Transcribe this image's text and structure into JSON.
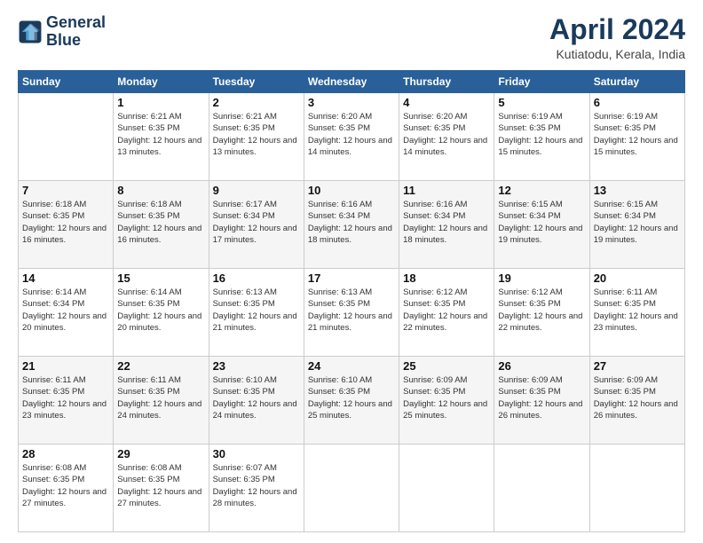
{
  "logo": {
    "line1": "General",
    "line2": "Blue"
  },
  "title": "April 2024",
  "subtitle": "Kutiatodu, Kerala, India",
  "days_of_week": [
    "Sunday",
    "Monday",
    "Tuesday",
    "Wednesday",
    "Thursday",
    "Friday",
    "Saturday"
  ],
  "weeks": [
    [
      {
        "day": "",
        "sunrise": "",
        "sunset": "",
        "daylight": ""
      },
      {
        "day": "1",
        "sunrise": "Sunrise: 6:21 AM",
        "sunset": "Sunset: 6:35 PM",
        "daylight": "Daylight: 12 hours and 13 minutes."
      },
      {
        "day": "2",
        "sunrise": "Sunrise: 6:21 AM",
        "sunset": "Sunset: 6:35 PM",
        "daylight": "Daylight: 12 hours and 13 minutes."
      },
      {
        "day": "3",
        "sunrise": "Sunrise: 6:20 AM",
        "sunset": "Sunset: 6:35 PM",
        "daylight": "Daylight: 12 hours and 14 minutes."
      },
      {
        "day": "4",
        "sunrise": "Sunrise: 6:20 AM",
        "sunset": "Sunset: 6:35 PM",
        "daylight": "Daylight: 12 hours and 14 minutes."
      },
      {
        "day": "5",
        "sunrise": "Sunrise: 6:19 AM",
        "sunset": "Sunset: 6:35 PM",
        "daylight": "Daylight: 12 hours and 15 minutes."
      },
      {
        "day": "6",
        "sunrise": "Sunrise: 6:19 AM",
        "sunset": "Sunset: 6:35 PM",
        "daylight": "Daylight: 12 hours and 15 minutes."
      }
    ],
    [
      {
        "day": "7",
        "sunrise": "Sunrise: 6:18 AM",
        "sunset": "Sunset: 6:35 PM",
        "daylight": "Daylight: 12 hours and 16 minutes."
      },
      {
        "day": "8",
        "sunrise": "Sunrise: 6:18 AM",
        "sunset": "Sunset: 6:35 PM",
        "daylight": "Daylight: 12 hours and 16 minutes."
      },
      {
        "day": "9",
        "sunrise": "Sunrise: 6:17 AM",
        "sunset": "Sunset: 6:34 PM",
        "daylight": "Daylight: 12 hours and 17 minutes."
      },
      {
        "day": "10",
        "sunrise": "Sunrise: 6:16 AM",
        "sunset": "Sunset: 6:34 PM",
        "daylight": "Daylight: 12 hours and 18 minutes."
      },
      {
        "day": "11",
        "sunrise": "Sunrise: 6:16 AM",
        "sunset": "Sunset: 6:34 PM",
        "daylight": "Daylight: 12 hours and 18 minutes."
      },
      {
        "day": "12",
        "sunrise": "Sunrise: 6:15 AM",
        "sunset": "Sunset: 6:34 PM",
        "daylight": "Daylight: 12 hours and 19 minutes."
      },
      {
        "day": "13",
        "sunrise": "Sunrise: 6:15 AM",
        "sunset": "Sunset: 6:34 PM",
        "daylight": "Daylight: 12 hours and 19 minutes."
      }
    ],
    [
      {
        "day": "14",
        "sunrise": "Sunrise: 6:14 AM",
        "sunset": "Sunset: 6:34 PM",
        "daylight": "Daylight: 12 hours and 20 minutes."
      },
      {
        "day": "15",
        "sunrise": "Sunrise: 6:14 AM",
        "sunset": "Sunset: 6:35 PM",
        "daylight": "Daylight: 12 hours and 20 minutes."
      },
      {
        "day": "16",
        "sunrise": "Sunrise: 6:13 AM",
        "sunset": "Sunset: 6:35 PM",
        "daylight": "Daylight: 12 hours and 21 minutes."
      },
      {
        "day": "17",
        "sunrise": "Sunrise: 6:13 AM",
        "sunset": "Sunset: 6:35 PM",
        "daylight": "Daylight: 12 hours and 21 minutes."
      },
      {
        "day": "18",
        "sunrise": "Sunrise: 6:12 AM",
        "sunset": "Sunset: 6:35 PM",
        "daylight": "Daylight: 12 hours and 22 minutes."
      },
      {
        "day": "19",
        "sunrise": "Sunrise: 6:12 AM",
        "sunset": "Sunset: 6:35 PM",
        "daylight": "Daylight: 12 hours and 22 minutes."
      },
      {
        "day": "20",
        "sunrise": "Sunrise: 6:11 AM",
        "sunset": "Sunset: 6:35 PM",
        "daylight": "Daylight: 12 hours and 23 minutes."
      }
    ],
    [
      {
        "day": "21",
        "sunrise": "Sunrise: 6:11 AM",
        "sunset": "Sunset: 6:35 PM",
        "daylight": "Daylight: 12 hours and 23 minutes."
      },
      {
        "day": "22",
        "sunrise": "Sunrise: 6:11 AM",
        "sunset": "Sunset: 6:35 PM",
        "daylight": "Daylight: 12 hours and 24 minutes."
      },
      {
        "day": "23",
        "sunrise": "Sunrise: 6:10 AM",
        "sunset": "Sunset: 6:35 PM",
        "daylight": "Daylight: 12 hours and 24 minutes."
      },
      {
        "day": "24",
        "sunrise": "Sunrise: 6:10 AM",
        "sunset": "Sunset: 6:35 PM",
        "daylight": "Daylight: 12 hours and 25 minutes."
      },
      {
        "day": "25",
        "sunrise": "Sunrise: 6:09 AM",
        "sunset": "Sunset: 6:35 PM",
        "daylight": "Daylight: 12 hours and 25 minutes."
      },
      {
        "day": "26",
        "sunrise": "Sunrise: 6:09 AM",
        "sunset": "Sunset: 6:35 PM",
        "daylight": "Daylight: 12 hours and 26 minutes."
      },
      {
        "day": "27",
        "sunrise": "Sunrise: 6:09 AM",
        "sunset": "Sunset: 6:35 PM",
        "daylight": "Daylight: 12 hours and 26 minutes."
      }
    ],
    [
      {
        "day": "28",
        "sunrise": "Sunrise: 6:08 AM",
        "sunset": "Sunset: 6:35 PM",
        "daylight": "Daylight: 12 hours and 27 minutes."
      },
      {
        "day": "29",
        "sunrise": "Sunrise: 6:08 AM",
        "sunset": "Sunset: 6:35 PM",
        "daylight": "Daylight: 12 hours and 27 minutes."
      },
      {
        "day": "30",
        "sunrise": "Sunrise: 6:07 AM",
        "sunset": "Sunset: 6:35 PM",
        "daylight": "Daylight: 12 hours and 28 minutes."
      },
      {
        "day": "",
        "sunrise": "",
        "sunset": "",
        "daylight": ""
      },
      {
        "day": "",
        "sunrise": "",
        "sunset": "",
        "daylight": ""
      },
      {
        "day": "",
        "sunrise": "",
        "sunset": "",
        "daylight": ""
      },
      {
        "day": "",
        "sunrise": "",
        "sunset": "",
        "daylight": ""
      }
    ]
  ]
}
